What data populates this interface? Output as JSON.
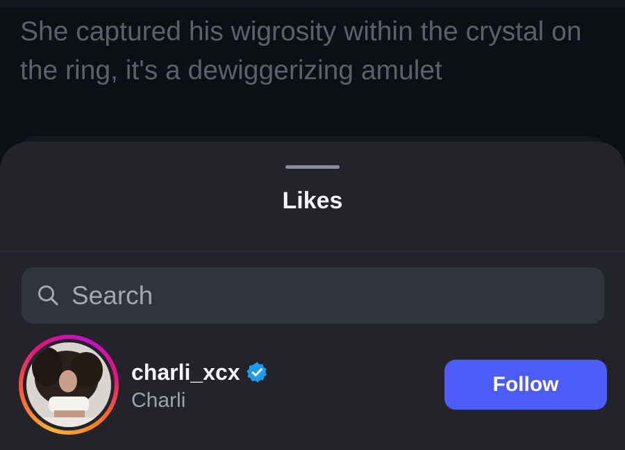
{
  "background_post": {
    "text": "She captured his wigrosity within the crystal on the ring, it's a dewiggerizing amulet"
  },
  "sheet": {
    "title": "Likes"
  },
  "search": {
    "placeholder": "Search",
    "value": "",
    "icon": "search-icon"
  },
  "likes_list": [
    {
      "username": "charli_xcx",
      "display_name": "Charli",
      "verified": true,
      "story_ring": true,
      "follow_label": "Follow"
    }
  ],
  "colors": {
    "accent": "#4d5bf9",
    "verified": "#1d9bf0",
    "sheet_bg": "#222429",
    "search_bg": "#30343d"
  }
}
